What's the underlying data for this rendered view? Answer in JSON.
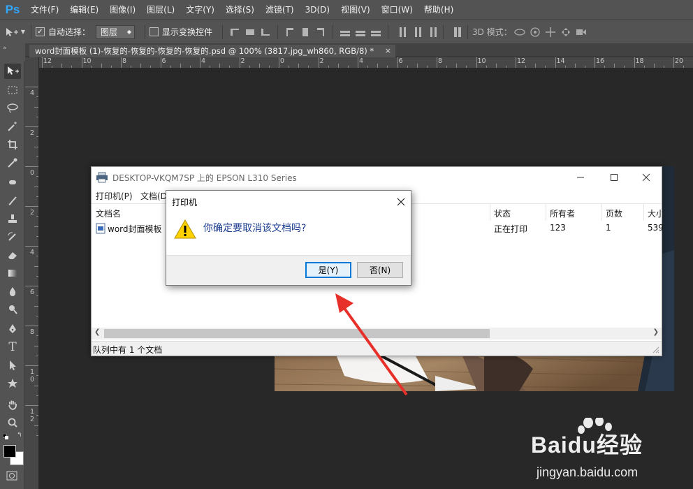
{
  "app": {
    "logo": "Ps",
    "menu": [
      "文件(F)",
      "编辑(E)",
      "图像(I)",
      "图层(L)",
      "文字(Y)",
      "选择(S)",
      "滤镜(T)",
      "3D(D)",
      "视图(V)",
      "窗口(W)",
      "帮助(H)"
    ]
  },
  "options": {
    "auto_select_label": "自动选择：",
    "auto_select_target": "图层",
    "show_transform_label": "显示变换控件",
    "mode_3d_label": "3D 模式："
  },
  "document": {
    "tab_title": "word封面模板 (1)-恢复的-恢复的-恢复的-恢复的.psd @ 100% (3817.jpg_wh860, RGB/8) *",
    "close": "×"
  },
  "rulers": {
    "h_labels": [
      "12",
      "10",
      "8",
      "6",
      "4",
      "2",
      "0",
      "2",
      "4",
      "6",
      "8",
      "10",
      "12",
      "14",
      "16",
      "18",
      "20"
    ],
    "v_labels": [
      "4",
      "2",
      "0",
      "2",
      "4",
      "6",
      "8",
      "1\n0",
      "1\n2"
    ]
  },
  "queue_window": {
    "title": "DESKTOP-VKQM7SP 上的 EPSON L310 Series",
    "menu": [
      "打印机(P)",
      "文档(D)"
    ],
    "columns": [
      "文档名",
      "状态",
      "所有者",
      "页数",
      "大小"
    ],
    "row": {
      "name": "word封面模板",
      "status": "正在打印",
      "owner": "123",
      "pages": "1",
      "size": "539"
    },
    "status_text": "队列中有 1 个文档"
  },
  "confirm_dialog": {
    "title": "打印机",
    "message": "你确定要取消该文档吗?",
    "yes_label": "是(Y)",
    "no_label": "否(N)"
  },
  "watermark": {
    "brand": "Baidu经验",
    "url": "jingyan.baidu.com"
  },
  "colors": {
    "ps_accent": "#31a8ff",
    "dialog_text": "#1d3f8f",
    "arrow": "#e8302a",
    "default_button_border": "#0078d7"
  }
}
